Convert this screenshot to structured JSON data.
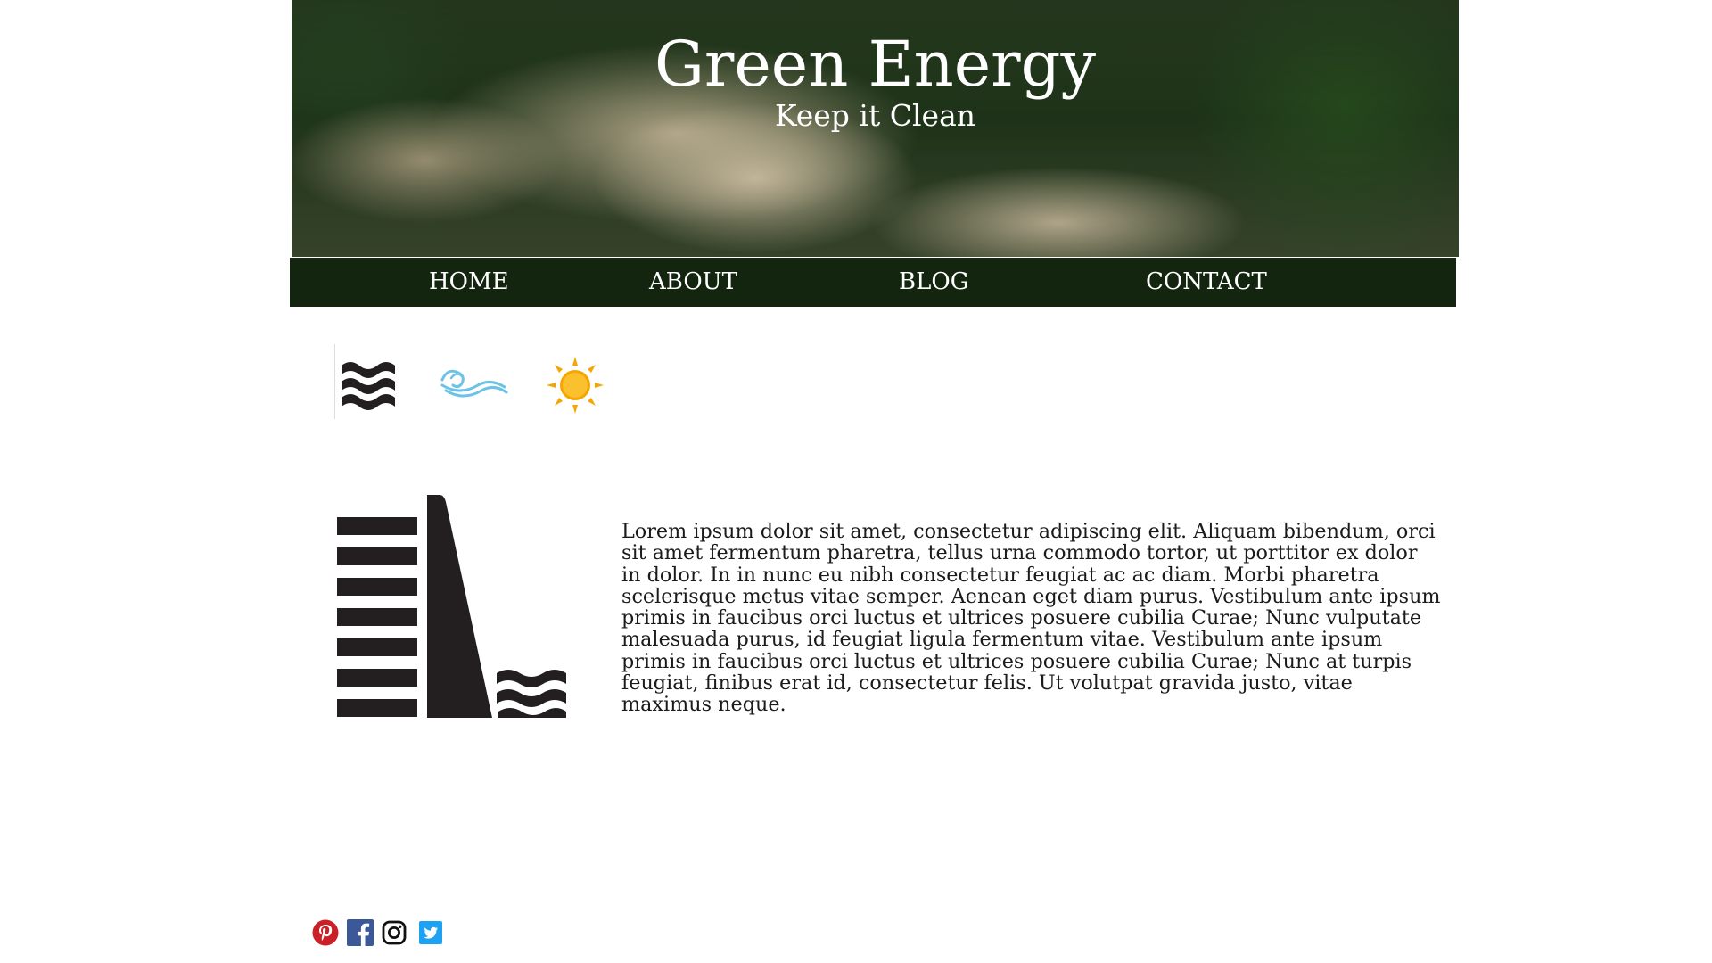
{
  "header": {
    "title": "Green Energy",
    "tagline": "Keep it Clean"
  },
  "nav": {
    "items": [
      {
        "label": "HOME"
      },
      {
        "label": "ABOUT"
      },
      {
        "label": "BLOG"
      },
      {
        "label": "CONTACT"
      }
    ]
  },
  "energy_icons": [
    "water-icon",
    "wind-icon",
    "sun-icon"
  ],
  "feature": {
    "icon": "dam-icon",
    "text": "Lorem ipsum dolor sit amet, consectetur adipiscing elit. Aliquam bibendum, orci sit amet fermentum pharetra, tellus urna commodo tortor, ut porttitor ex dolor in dolor. In in nunc eu nibh consectetur feugiat ac ac diam. Morbi pharetra scelerisque metus vitae semper. Aenean eget diam purus. Vestibulum ante ipsum primis in faucibus orci luctus et ultrices posuere cubilia Curae; Nunc vulputate malesuada purus, id feugiat ligula fermentum vitae. Vestibulum ante ipsum primis in faucibus orci luctus et ultrices posuere cubilia Curae; Nunc at turpis feugiat, finibus erat id, consectetur felis. Ut volutpat gravida justo, vitae maximus neque."
  },
  "social": [
    "pinterest-icon",
    "facebook-icon",
    "instagram-icon",
    "twitter-icon"
  ],
  "colors": {
    "nav_background": "#13240f",
    "text": "#1b1b1b",
    "icon_black": "#231f20",
    "wind_blue": "#6cc3e6",
    "sun_orange": "#f7a600",
    "sun_yellow": "#fbc02d",
    "pinterest_red": "#cb2027",
    "facebook_blue": "#3b5998",
    "twitter_blue": "#1da1f2"
  }
}
